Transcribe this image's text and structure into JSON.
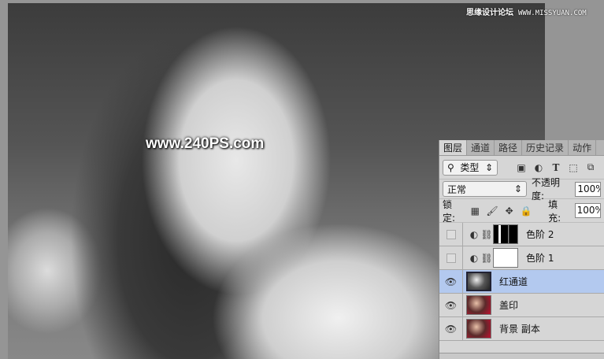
{
  "watermarks": {
    "site": "www.240PS.com",
    "top_cn": "思缘设计论坛",
    "top_url": "WWW.MISSYUAN.COM"
  },
  "panel": {
    "tabs": [
      {
        "label": "图层",
        "active": true
      },
      {
        "label": "通道"
      },
      {
        "label": "路径"
      },
      {
        "label": "历史记录"
      },
      {
        "label": "动作"
      }
    ],
    "filter": {
      "label": "类型",
      "icons": [
        "image-icon",
        "adjustment-icon",
        "type-icon",
        "shape-icon",
        "smart-object-icon"
      ]
    },
    "blend_mode": "正常",
    "opacity_label": "不透明度:",
    "opacity": "100%",
    "lock_label": "锁定:",
    "fill_label": "填充:",
    "fill": "100%",
    "layers": [
      {
        "name": "色阶 2",
        "visible": false,
        "type": "adjustment",
        "mask": "black"
      },
      {
        "name": "色阶 1",
        "visible": false,
        "type": "adjustment",
        "mask": "white"
      },
      {
        "name": "红通道",
        "visible": true,
        "selected": true
      },
      {
        "name": "盖印",
        "visible": true
      },
      {
        "name": "背景 副本",
        "visible": true
      }
    ]
  }
}
